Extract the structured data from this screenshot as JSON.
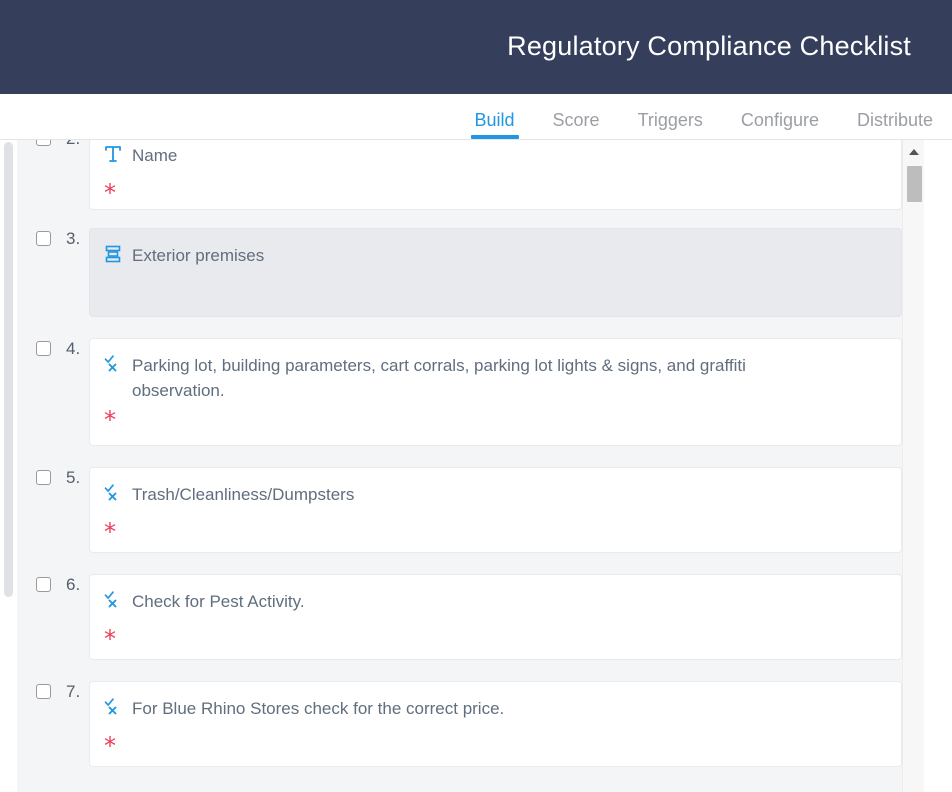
{
  "header": {
    "title": "Regulatory Compliance Checklist",
    "background_color": "#353F5B"
  },
  "tabs": {
    "accent_color": "#2196E3",
    "items": [
      {
        "label": "Build",
        "active": true
      },
      {
        "label": "Score",
        "active": false
      },
      {
        "label": "Triggers",
        "active": false
      },
      {
        "label": "Configure",
        "active": false
      },
      {
        "label": "Distribute",
        "active": false
      }
    ]
  },
  "colors": {
    "page_background": "#F4F5F6",
    "card_background": "#FFFFFF",
    "section_background": "#E8EAEE",
    "required_star": "#EF3B5B",
    "icon_blue": "#2196E3",
    "label_text": "#606E7E"
  },
  "checklist": {
    "items": [
      {
        "number": "2.",
        "icon": "text-field-icon",
        "label": "Name",
        "type": "question",
        "required_marker": "*",
        "checked": false
      },
      {
        "number": "3.",
        "icon": "section-icon",
        "label": "Exterior premises",
        "type": "section",
        "required_marker": "",
        "checked": false
      },
      {
        "number": "4.",
        "icon": "pass-fail-icon",
        "label": "Parking lot, building parameters, cart corrals, parking lot lights & signs, and graffiti observation.",
        "type": "question",
        "required_marker": "*",
        "checked": false
      },
      {
        "number": "5.",
        "icon": "pass-fail-icon",
        "label": "Trash/Cleanliness/Dumpsters",
        "type": "question",
        "required_marker": "*",
        "checked": false
      },
      {
        "number": "6.",
        "icon": "pass-fail-icon",
        "label": "Check for Pest Activity.",
        "type": "question",
        "required_marker": "*",
        "checked": false
      },
      {
        "number": "7.",
        "icon": "pass-fail-icon",
        "label": "For Blue Rhino Stores check for the correct price.",
        "type": "question",
        "required_marker": "*",
        "checked": false
      }
    ]
  },
  "scrollbars": {
    "inner_up_arrow_icon": "chevron-up-icon"
  }
}
